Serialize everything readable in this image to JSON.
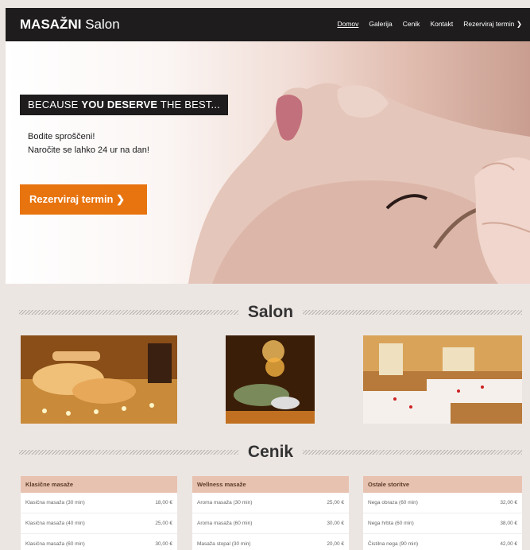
{
  "nav": {
    "brand_bold": "MASAŽNI",
    "brand_light": "Salon",
    "items": [
      {
        "label": "Domov"
      },
      {
        "label": "Galerija"
      },
      {
        "label": "Cenik"
      },
      {
        "label": "Kontakt"
      },
      {
        "label": "Rezerviraj termin ❯"
      }
    ]
  },
  "hero": {
    "tagline_prefix": "BECAUSE ",
    "tagline_bold": "YOU DESERVE",
    "tagline_suffix": " THE BEST...",
    "line1": "Bodite sproščeni!",
    "line2": "Naročite se lahko 24 ur na dan!",
    "cta": "Rezerviraj termin ❯"
  },
  "sections": {
    "salon": "Salon",
    "cenik": "Cenik"
  },
  "price_tables": [
    {
      "title": "Klasične masaže",
      "rows": [
        {
          "name": "Klasična masaža (30 min)",
          "price": "18,00 €"
        },
        {
          "name": "Klasična masaža (40 min)",
          "price": "25,00 €"
        },
        {
          "name": "Klasična masaža (60 min)",
          "price": "30,00 €"
        }
      ]
    },
    {
      "title": "Wellness masaže",
      "rows": [
        {
          "name": "Aroma masaža (30 min)",
          "price": "25,00 €"
        },
        {
          "name": "Aroma masaža (60 min)",
          "price": "30,00 €"
        },
        {
          "name": "Masaža stopal (30 min)",
          "price": "20,00 €"
        }
      ]
    },
    {
      "title": "Ostale storitve",
      "rows": [
        {
          "name": "Nega obraza (60 min)",
          "price": "32,00 €"
        },
        {
          "name": "Nega hrbta (60 min)",
          "price": "38,00 €"
        },
        {
          "name": "Čistilna nega (90 min)",
          "price": "42,00 €"
        }
      ]
    }
  ],
  "colors": {
    "nav_bg": "#1e1c1c",
    "accent": "#e8740f",
    "table_head": "#e8c2b0",
    "page_bg": "#ece6e3"
  }
}
